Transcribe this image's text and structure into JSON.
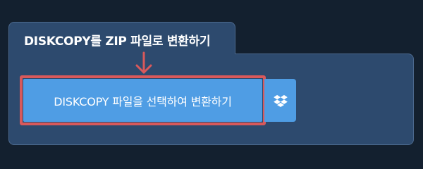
{
  "panel": {
    "title": "DISKCOPY를 ZIP 파일로 변환하기"
  },
  "convert": {
    "button_label": "DISKCOPY 파일을 선택하여 변환하기"
  },
  "icons": {
    "arrow": "arrow-down-icon",
    "dropbox": "dropbox-icon"
  },
  "colors": {
    "background": "#13202f",
    "panel": "#2d4a6e",
    "button": "#4f9de4",
    "highlight": "#d9595b"
  }
}
